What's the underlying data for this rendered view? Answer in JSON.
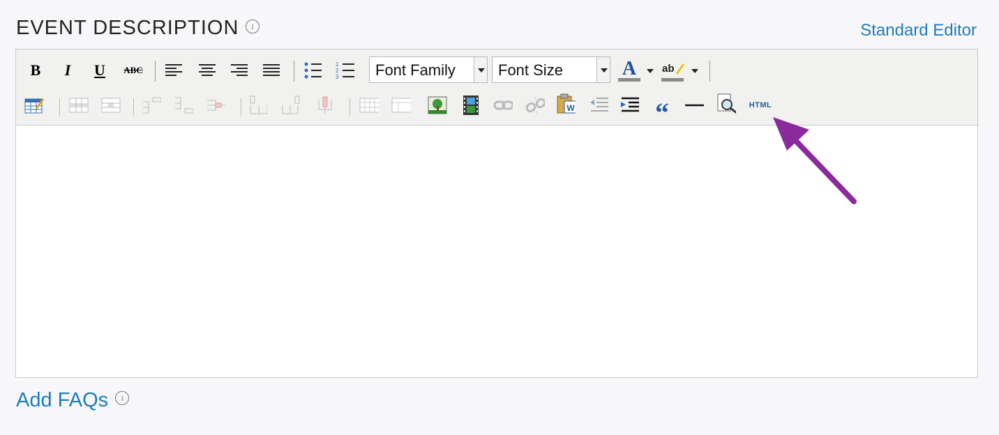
{
  "header": {
    "title": "EVENT DESCRIPTION",
    "info_icon": "info-icon",
    "standard_editor_link": "Standard Editor"
  },
  "toolbar": {
    "font_family": "Font Family",
    "font_size": "Font Size",
    "html_button_label": "HTML",
    "row1_icons": [
      "bold-icon",
      "italic-icon",
      "underline-icon",
      "strikethrough-icon",
      "align-left-icon",
      "align-center-icon",
      "align-right-icon",
      "align-justify-icon",
      "bullet-list-icon",
      "numbered-list-icon",
      "text-color-icon",
      "highlight-color-icon"
    ],
    "row2_icons": [
      "edit-table-icon",
      "row-properties-icon",
      "cell-properties-icon",
      "insert-row-before-icon",
      "insert-row-after-icon",
      "delete-row-icon",
      "insert-col-before-icon",
      "insert-col-after-icon",
      "delete-col-icon",
      "split-cells-icon",
      "merge-cells-icon",
      "insert-image-icon",
      "insert-media-icon",
      "link-icon",
      "unlink-icon",
      "paste-from-word-icon",
      "outdent-icon",
      "indent-icon",
      "blockquote-icon",
      "horizontal-rule-icon",
      "preview-icon",
      "html-source-icon"
    ]
  },
  "footer": {
    "add_faqs": "Add FAQs"
  },
  "colors": {
    "link": "#1d7db8",
    "annotation_arrow": "#8a2a9c"
  }
}
